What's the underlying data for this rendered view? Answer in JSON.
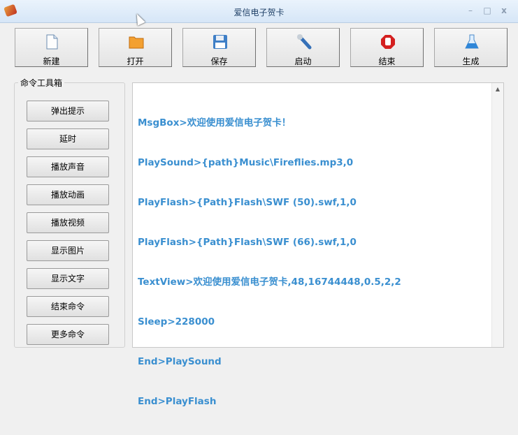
{
  "window": {
    "title": "爱信电子贺卡",
    "minimize": "–",
    "maximize": "□",
    "close": "x"
  },
  "toolbar": [
    {
      "label": "新建",
      "icon": "new-file-icon"
    },
    {
      "label": "打开",
      "icon": "folder-icon"
    },
    {
      "label": "保存",
      "icon": "save-icon"
    },
    {
      "label": "启动",
      "icon": "wrench-icon"
    },
    {
      "label": "结束",
      "icon": "stop-hand-icon"
    },
    {
      "label": "生成",
      "icon": "flask-icon"
    }
  ],
  "toolbox": {
    "title": "命令工具箱",
    "buttons": [
      "弹出提示",
      "延时",
      "播放声音",
      "播放动画",
      "播放视频",
      "显示图片",
      "显示文字",
      "结束命令",
      "更多命令"
    ]
  },
  "editor": {
    "lines": [
      "MsgBox>欢迎使用爱信电子贺卡！",
      "PlaySound>{path}Music\\Fireflies.mp3,0",
      "PlayFlash>{Path}Flash\\SWF (50).swf,1,0",
      "PlayFlash>{Path}Flash\\SWF (66).swf,1,0",
      "TextView>欢迎使用爱信电子贺卡,48,16744448,0.5,2,2",
      "Sleep>228000",
      "End>PlaySound",
      "End>PlayFlash"
    ]
  },
  "colors": {
    "script_text": "#3a8fd0"
  }
}
